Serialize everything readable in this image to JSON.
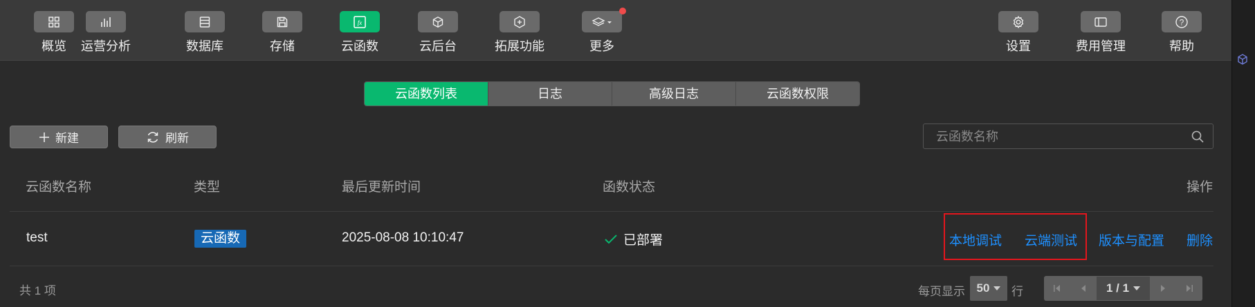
{
  "toolbar": {
    "items": [
      {
        "label": "概览",
        "icon": "overview-icon"
      },
      {
        "label": "运营分析",
        "icon": "analytics-icon"
      },
      {
        "label": "数据库",
        "icon": "database-icon"
      },
      {
        "label": "存储",
        "icon": "storage-icon"
      },
      {
        "label": "云函数",
        "icon": "cloud-function-icon"
      },
      {
        "label": "云后台",
        "icon": "cloud-backend-icon"
      },
      {
        "label": "拓展功能",
        "icon": "extension-icon"
      },
      {
        "label": "更多",
        "icon": "more-layers-icon"
      }
    ],
    "right_items": [
      {
        "label": "设置",
        "icon": "gear-icon"
      },
      {
        "label": "费用管理",
        "icon": "billing-icon"
      },
      {
        "label": "帮助",
        "icon": "help-icon"
      }
    ],
    "active_color": "#09b86f",
    "notification_color": "#f04b4b"
  },
  "tabs": [
    {
      "label": "云函数列表",
      "active": true
    },
    {
      "label": "日志",
      "active": false
    },
    {
      "label": "高级日志",
      "active": false
    },
    {
      "label": "云函数权限",
      "active": false
    }
  ],
  "actions": {
    "new_label": "新建",
    "refresh_label": "刷新"
  },
  "search": {
    "placeholder": "云函数名称"
  },
  "table": {
    "headers": {
      "name": "云函数名称",
      "type": "类型",
      "updated": "最后更新时间",
      "status": "函数状态",
      "ops": "操作"
    },
    "rows": [
      {
        "name": "test",
        "type": "云函数",
        "updated": "2025-08-08 10:10:47",
        "status": "已部署",
        "ops": {
          "local_debug": "本地调试",
          "cloud_test": "云端测试",
          "version_config": "版本与配置",
          "delete": "删除"
        }
      }
    ],
    "link_color": "#1e90ff",
    "badge_color": "#1769b5"
  },
  "footer": {
    "total": "共 1 项",
    "per_page_label": "每页显示",
    "per_page_value": "50",
    "per_page_suffix": "行",
    "page_display": "1 / 1"
  }
}
